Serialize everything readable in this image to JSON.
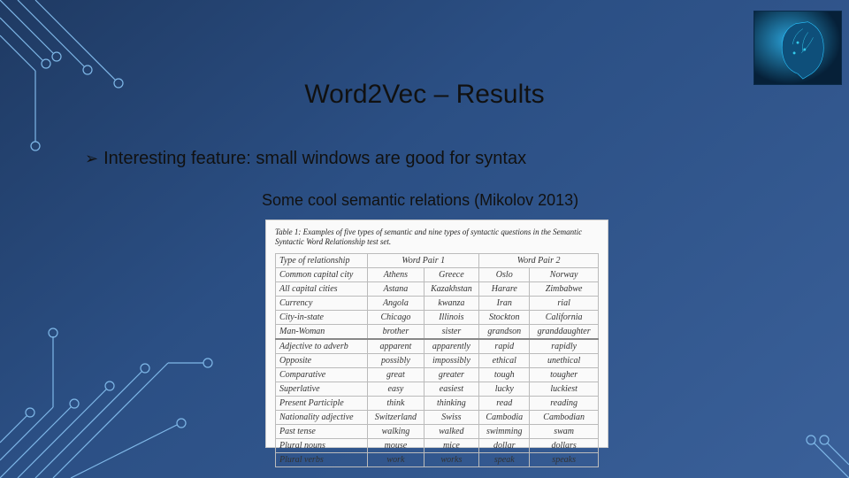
{
  "title": "Word2Vec – Results",
  "bullet": "Interesting feature: small windows are good for syntax",
  "subcaption": "Some cool semantic relations (Mikolov 2013)",
  "table": {
    "caption": "Table 1: Examples of five types of semantic and nine types of syntactic questions in the Semantic Syntactic Word Relationship test set.",
    "headers": [
      "Type of relationship",
      "Word Pair 1",
      "Word Pair 2"
    ],
    "rows": [
      {
        "rel": "Common capital city",
        "a": "Athens",
        "b": "Greece",
        "c": "Oslo",
        "d": "Norway"
      },
      {
        "rel": "All capital cities",
        "a": "Astana",
        "b": "Kazakhstan",
        "c": "Harare",
        "d": "Zimbabwe"
      },
      {
        "rel": "Currency",
        "a": "Angola",
        "b": "kwanza",
        "c": "Iran",
        "d": "rial"
      },
      {
        "rel": "City-in-state",
        "a": "Chicago",
        "b": "Illinois",
        "c": "Stockton",
        "d": "California"
      },
      {
        "rel": "Man-Woman",
        "a": "brother",
        "b": "sister",
        "c": "grandson",
        "d": "granddaughter"
      },
      {
        "rel": "Adjective to adverb",
        "a": "apparent",
        "b": "apparently",
        "c": "rapid",
        "d": "rapidly",
        "sep": true
      },
      {
        "rel": "Opposite",
        "a": "possibly",
        "b": "impossibly",
        "c": "ethical",
        "d": "unethical"
      },
      {
        "rel": "Comparative",
        "a": "great",
        "b": "greater",
        "c": "tough",
        "d": "tougher"
      },
      {
        "rel": "Superlative",
        "a": "easy",
        "b": "easiest",
        "c": "lucky",
        "d": "luckiest"
      },
      {
        "rel": "Present Participle",
        "a": "think",
        "b": "thinking",
        "c": "read",
        "d": "reading"
      },
      {
        "rel": "Nationality adjective",
        "a": "Switzerland",
        "b": "Swiss",
        "c": "Cambodia",
        "d": "Cambodian"
      },
      {
        "rel": "Past tense",
        "a": "walking",
        "b": "walked",
        "c": "swimming",
        "d": "swam"
      },
      {
        "rel": "Plural nouns",
        "a": "mouse",
        "b": "mice",
        "c": "dollar",
        "d": "dollars"
      },
      {
        "rel": "Plural verbs",
        "a": "work",
        "b": "works",
        "c": "speak",
        "d": "speaks"
      }
    ]
  }
}
